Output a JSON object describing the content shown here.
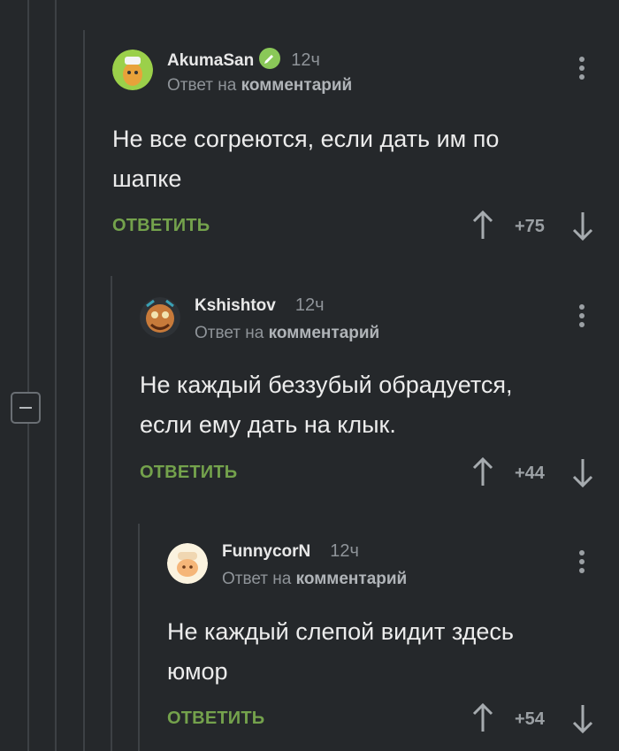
{
  "comments": [
    {
      "author": "AkumaSan",
      "verified": true,
      "time": "12ч",
      "reply_prefix": "Ответ на",
      "reply_link": "комментарий",
      "text_line1": "Не все согреются, если дать им по",
      "text_line2": "шапке",
      "reply_label": "ОТВЕТИТЬ",
      "rating": "+75"
    },
    {
      "author": "Kshishtov",
      "verified": false,
      "time": "12ч",
      "reply_prefix": "Ответ на",
      "reply_link": "комментарий",
      "text_line1": "Не каждый беззубый обрадуется,",
      "text_line2": "если ему дать на клык.",
      "reply_label": "ОТВЕТИТЬ",
      "rating": "+44"
    },
    {
      "author": "FunnycorN",
      "verified": false,
      "time": "12ч",
      "reply_prefix": "Ответ на",
      "reply_link": "комментарий",
      "text_line1": "Не каждый слепой видит здесь",
      "text_line2": "юмор",
      "reply_label": "ОТВЕТИТЬ",
      "rating": "+54"
    }
  ],
  "colors": {
    "background": "#25282b",
    "accent_green": "#74a24c",
    "muted": "#8f9499"
  },
  "icons": [
    "verified-icon",
    "more-icon",
    "upvote-icon",
    "downvote-icon",
    "collapse-icon"
  ]
}
